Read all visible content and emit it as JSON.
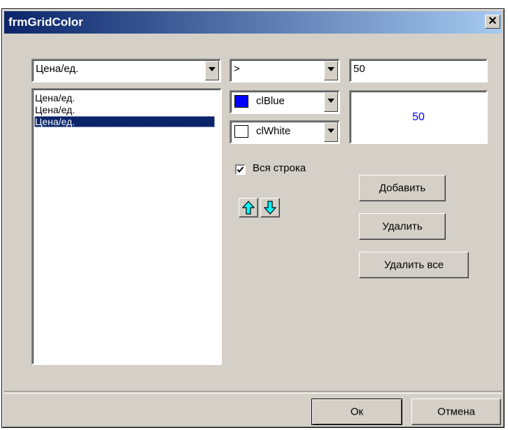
{
  "window": {
    "title": "frmGridColor"
  },
  "field_combo": {
    "value": "Цена/ед."
  },
  "operator_combo": {
    "value": ">"
  },
  "value_input": {
    "value": "50"
  },
  "rules_list": {
    "items": [
      "Цена/ед.",
      "Цена/ед.",
      "Цена/ед."
    ],
    "selected_index": 2
  },
  "font_color_combo": {
    "value": "clBlue",
    "swatch": "#0000ff"
  },
  "bg_color_combo": {
    "value": "clWhite",
    "swatch": "#ffffff"
  },
  "preview": {
    "text": "50",
    "color": "#0000ff",
    "background": "#ffffff"
  },
  "whole_row_checkbox": {
    "label": "Вся строка",
    "checked": true
  },
  "buttons": {
    "add": "Добавить",
    "delete": "Удалить",
    "delete_all": "Удалить все",
    "ok": "Ок",
    "cancel": "Отмена"
  },
  "icons": {
    "move_up": "arrow-up-icon",
    "move_down": "arrow-down-icon",
    "close": "close-icon"
  }
}
